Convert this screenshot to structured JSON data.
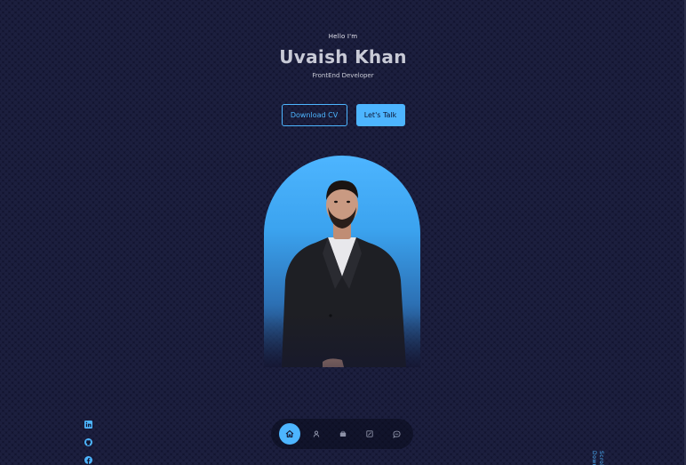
{
  "hero": {
    "greeting": "Hello I'm",
    "name": "Uvaish Khan",
    "role": "FrontEnd Developer"
  },
  "cta": {
    "download_cv_label": "Download CV",
    "lets_talk_label": "Let's Talk"
  },
  "socials": [
    {
      "icon": "linkedin-icon"
    },
    {
      "icon": "github-icon"
    },
    {
      "icon": "facebook-icon"
    }
  ],
  "nav": {
    "items": [
      {
        "icon": "home-icon",
        "active": true
      },
      {
        "icon": "user-icon",
        "active": false
      },
      {
        "icon": "briefcase-icon",
        "active": false
      },
      {
        "icon": "portfolio-icon",
        "active": false
      },
      {
        "icon": "message-icon",
        "active": false
      }
    ]
  },
  "scroll_down_label": "Scroll Down",
  "colors": {
    "background": "#131530",
    "accent": "#4db5ff",
    "text": "#ffffff"
  }
}
